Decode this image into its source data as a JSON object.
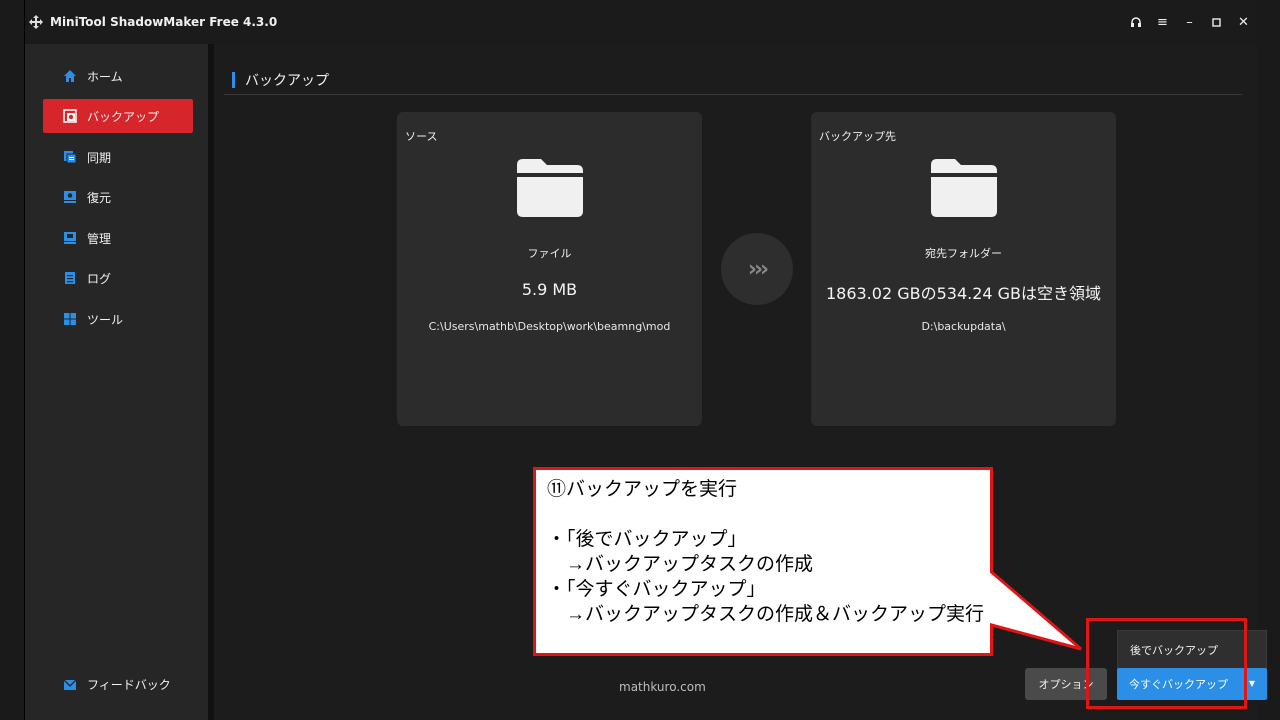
{
  "app": {
    "title": "MiniTool ShadowMaker Free 4.3.0",
    "controls": [
      "headset-icon",
      "menu-icon",
      "minimize-icon",
      "maximize-icon",
      "close-icon"
    ],
    "control_glyphs": {
      "headset": "♫",
      "menu": "≡",
      "minimize": "–",
      "maximize": "▫",
      "close": "✕"
    }
  },
  "sidebar": {
    "items": [
      {
        "label": "ホーム",
        "icon": "home-icon"
      },
      {
        "label": "バックアップ",
        "icon": "backup-icon",
        "active": true
      },
      {
        "label": "同期",
        "icon": "sync-icon"
      },
      {
        "label": "復元",
        "icon": "restore-icon"
      },
      {
        "label": "管理",
        "icon": "manage-icon"
      },
      {
        "label": "ログ",
        "icon": "log-icon"
      },
      {
        "label": "ツール",
        "icon": "tools-icon"
      }
    ],
    "feedback": "フィードバック"
  },
  "main": {
    "header": "バックアップ",
    "source": {
      "label": "ソース",
      "type": "ファイル",
      "size": "5.9 MB",
      "path": "C:\\Users\\mathb\\Desktop\\work\\beamng\\mod"
    },
    "arrow": "›››",
    "destination": {
      "label": "バックアップ先",
      "type": "宛先フォルダー",
      "space": "1863.02 GBの534.24 GBは空き領域",
      "path": "D:\\backupdata\\"
    },
    "watermark": "mathkuro.com",
    "options_label": "オプション",
    "backup_later_label": "後でバックアップ",
    "backup_now_label": "今すぐバックアップ",
    "caret": "▼"
  },
  "annotation": {
    "text": "⑪バックアップを実行\n\n・「後でバックアップ」\n　→バックアップタスクの作成\n・「今すぐバックアップ」\n　→バックアップタスクの作成＆バックアップ実行",
    "border_color": "#e01515"
  },
  "colors": {
    "accent_red": "#d7262b",
    "accent_blue": "#2b8fe8",
    "annotation_red": "#e01515"
  }
}
